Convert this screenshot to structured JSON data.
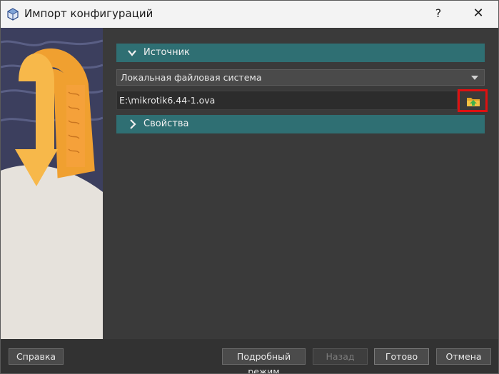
{
  "window": {
    "title": "Импорт конфигураций",
    "help_glyph": "?",
    "close_glyph": "✕"
  },
  "source_section": {
    "label": "Источник",
    "expanded": true,
    "source_type": "Локальная файловая система",
    "file_path": "E:\\mikrotik6.44-1.ova"
  },
  "properties_section": {
    "label": "Свойства",
    "expanded": false
  },
  "buttons": {
    "help": "Справка",
    "expert_mode": "Подробный режим",
    "back": "Назад",
    "finish": "Готово",
    "cancel": "Отмена"
  },
  "icons": {
    "app": "virtualbox-icon",
    "browse": "folder-open-icon"
  },
  "colors": {
    "section_header": "#2f6f73",
    "highlight_box": "#e01010",
    "folder_icon": "#f5c242"
  }
}
